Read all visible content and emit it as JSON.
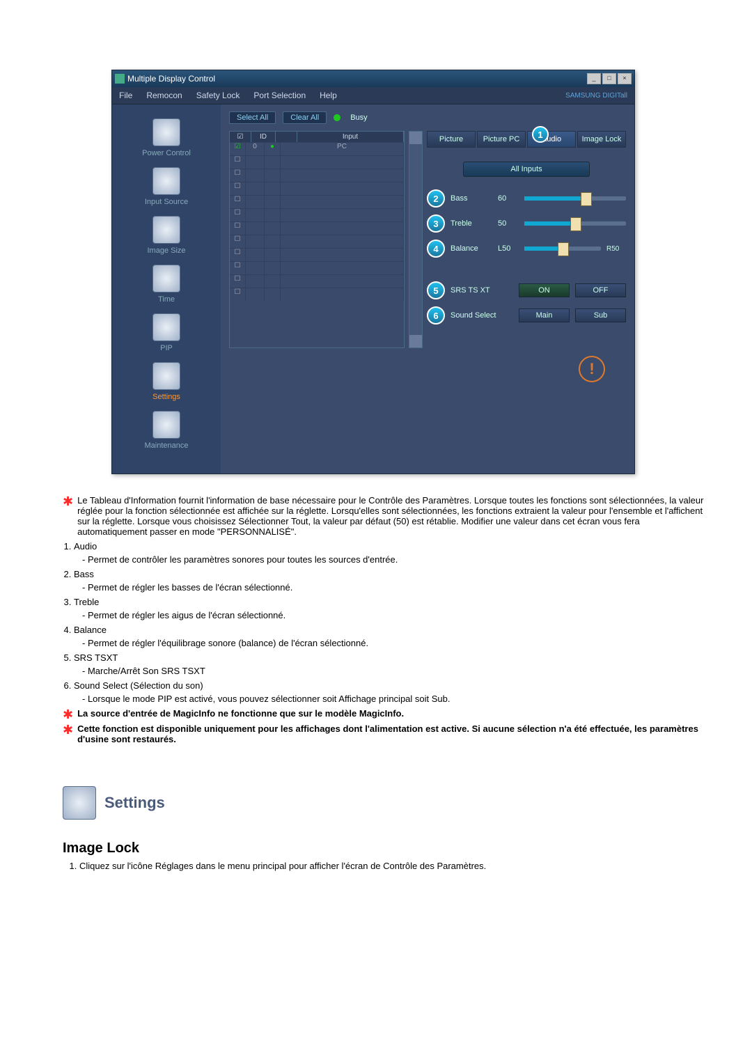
{
  "window": {
    "title": "Multiple Display Control",
    "menu": [
      "File",
      "Remocon",
      "Safety Lock",
      "Port Selection",
      "Help"
    ],
    "brand": "SAMSUNG DIGITall",
    "sidebar": [
      {
        "label": "Power Control"
      },
      {
        "label": "Input Source"
      },
      {
        "label": "Image Size"
      },
      {
        "label": "Time"
      },
      {
        "label": "PIP"
      },
      {
        "label": "Settings",
        "active": true
      },
      {
        "label": "Maintenance"
      }
    ],
    "select_all": "Select All",
    "clear_all": "Clear All",
    "busy": "Busy",
    "grid_headers": [
      "☑",
      "ID",
      "",
      "Input"
    ],
    "grid_row0": {
      "id": "0",
      "dot": "●",
      "input": "PC"
    },
    "tabs": [
      {
        "label": "Picture"
      },
      {
        "label": "Picture PC"
      },
      {
        "label": "Audio",
        "active": true,
        "num": "1"
      },
      {
        "label": "Image Lock"
      }
    ],
    "all_inputs": "All Inputs",
    "sliders": [
      {
        "num": "2",
        "label": "Bass",
        "value": "60",
        "pct": 60
      },
      {
        "num": "3",
        "label": "Treble",
        "value": "50",
        "pct": 50
      },
      {
        "num": "4",
        "label": "Balance",
        "value": "L50",
        "pct": 50,
        "right": "R50"
      }
    ],
    "btnrows": [
      {
        "num": "5",
        "label": "SRS TS XT",
        "on": "ON",
        "off": "OFF"
      },
      {
        "num": "6",
        "label": "Sound Select",
        "on": "Main",
        "off": "Sub"
      }
    ]
  },
  "doc": {
    "starnote1": "Le Tableau d'Information fournit l'information de base nécessaire pour le Contrôle des Paramètres. Lorsque toutes les fonctions sont sélectionnées, la valeur réglée pour la fonction sélectionnée est affichée sur la réglette. Lorsqu'elles sont sélectionnées, les fonctions extraient la valeur pour l'ensemble et l'affichent sur la réglette. Lorsque vous choisissez Sélectionner Tout, la valeur par défaut (50) est rétablie. Modifier une valeur dans cet écran vous fera automatiquement passer en mode \"PERSONNALISÉ\".",
    "items": [
      {
        "t": "Audio",
        "d": "- Permet de contrôler les paramètres sonores pour toutes les sources d'entrée."
      },
      {
        "t": "Bass",
        "d": "- Permet de régler les basses de l'écran sélectionné."
      },
      {
        "t": "Treble",
        "d": "- Permet de régler les aigus de l'écran sélectionné."
      },
      {
        "t": "Balance",
        "d": "- Permet de régler l'équilibrage sonore (balance) de l'écran sélectionné."
      },
      {
        "t": "SRS TSXT",
        "d": "- Marche/Arrêt Son SRS TSXT"
      },
      {
        "t": "Sound Select (Sélection du son)",
        "d": "- Lorsque le mode PIP est activé, vous pouvez sélectionner soit Affichage principal soit Sub."
      }
    ],
    "bold1": "La source d'entrée de MagicInfo ne fonctionne que sur le modèle MagicInfo.",
    "bold2": "Cette fonction est disponible uniquement pour les affichages dont l'alimentation est active. Si aucune sélection n'a été effectuée, les paramètres d'usine sont restaurés.",
    "section": "Settings",
    "subheading": "Image Lock",
    "step1": "Cliquez sur l'icône Réglages dans le menu principal pour afficher l'écran de Contrôle des Paramètres."
  }
}
